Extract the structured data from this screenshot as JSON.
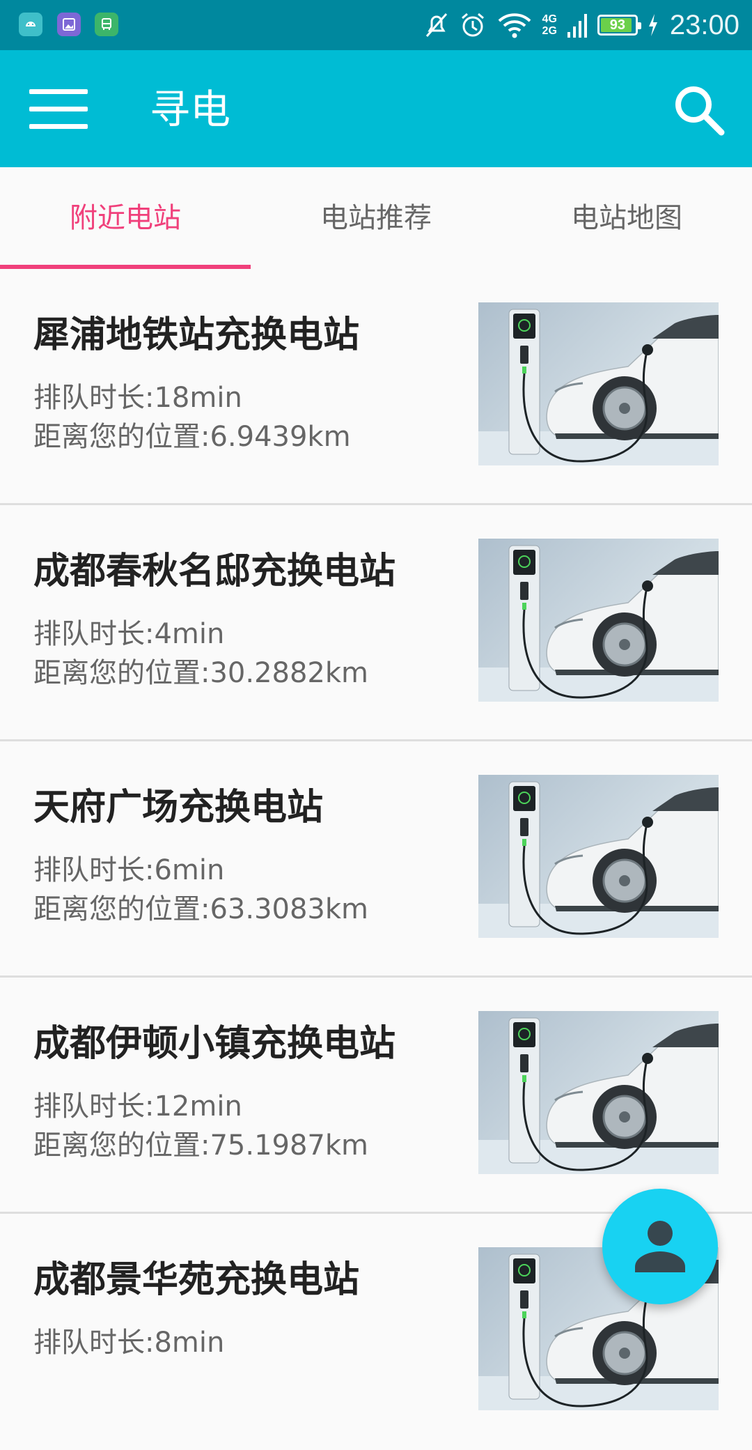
{
  "status_bar": {
    "time": "23:00",
    "battery_level": "93",
    "network_labels": [
      "4G",
      "2G"
    ],
    "icons": [
      "android-app-icon",
      "gallery-app-icon",
      "bus-app-icon",
      "mute-icon",
      "alarm-icon",
      "wifi-icon",
      "signal-icon",
      "battery-icon",
      "charging-icon"
    ]
  },
  "app_bar": {
    "title": "寻电",
    "menu_icon": "hamburger-menu-icon",
    "search_icon": "search-icon"
  },
  "tabs": [
    {
      "label": "附近电站",
      "active": true
    },
    {
      "label": "电站推荐",
      "active": false
    },
    {
      "label": "电站地图",
      "active": false
    }
  ],
  "stations": [
    {
      "name": "犀浦地铁站充换电站",
      "queue": "排队时长:18min",
      "distance": "距离您的位置:6.9439km"
    },
    {
      "name": "成都春秋名邸充换电站",
      "queue": "排队时长:4min",
      "distance": "距离您的位置:30.2882km"
    },
    {
      "name": "天府广场充换电站",
      "queue": "排队时长:6min",
      "distance": "距离您的位置:63.3083km"
    },
    {
      "name": "成都伊顿小镇充换电站",
      "queue": "排队时长:12min",
      "distance": "距离您的位置:75.1987km"
    },
    {
      "name": "成都景华苑充换电站",
      "queue": "排队时长:8min",
      "distance": ""
    }
  ],
  "fab": {
    "icon": "person-icon"
  },
  "colors": {
    "status_bar": "#00889e",
    "app_bar": "#00bcd4",
    "tab_active": "#f0407b",
    "fab": "#18d2f2"
  }
}
